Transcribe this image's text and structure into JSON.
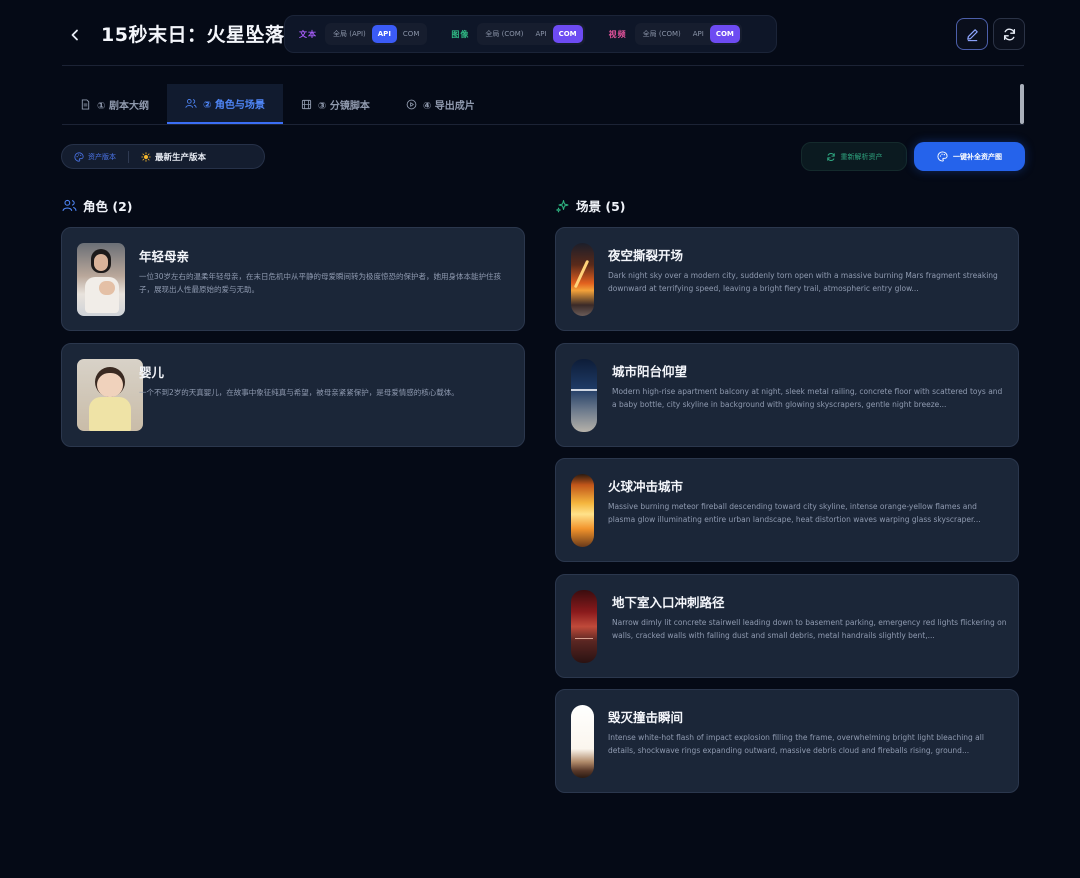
{
  "header": {
    "title": "15秒末日：火星坠落",
    "model_groups": [
      {
        "label": "文本",
        "color": "#a45cf6",
        "options": [
          "全局 (API)",
          "API",
          "COM"
        ],
        "selected": "API"
      },
      {
        "label": "图像",
        "color": "#2fb783",
        "options": [
          "全局 (COM)",
          "API",
          "COM"
        ],
        "selected": "COM"
      },
      {
        "label": "视频",
        "color": "#e0529a",
        "options": [
          "全局 (COM)",
          "API",
          "COM"
        ],
        "selected": "COM"
      }
    ]
  },
  "tabs": [
    {
      "label": "① 剧本大纲",
      "icon": "document-icon",
      "active": false
    },
    {
      "label": "② 角色与场景",
      "icon": "users-icon",
      "active": true
    },
    {
      "label": "③ 分镜脚本",
      "icon": "film-icon",
      "active": false
    },
    {
      "label": "④ 导出成片",
      "icon": "play-circle-icon",
      "active": false
    }
  ],
  "version": {
    "label": "资产版本",
    "value": "最新生产版本"
  },
  "actions": {
    "reparse": "重新解析资产",
    "fill_all": "一键补全资产图"
  },
  "characters": {
    "header": "角色 (2)",
    "items": [
      {
        "name": "年轻母亲",
        "desc": "一位30岁左右的温柔年轻母亲，在末日危机中从平静的母爱瞬间转为极度惊恐的保护者，她用身体本能护住孩子，展现出人性最原始的爱与无助。"
      },
      {
        "name": "婴儿",
        "desc": "一个不到2岁的天真婴儿，在故事中象征纯真与希望，被母亲紧紧保护，是母爱情感的核心载体。"
      }
    ]
  },
  "scenes": {
    "header": "场景 (5)",
    "items": [
      {
        "name": "夜空撕裂开场",
        "desc": "Dark night sky over a modern city, suddenly torn open with a massive burning Mars fragment streaking downward at terrifying speed, leaving a bright fiery trail, atmospheric entry glow..."
      },
      {
        "name": "城市阳台仰望",
        "desc": "Modern high-rise apartment balcony at night, sleek metal railing, concrete floor with scattered toys and a baby bottle, city skyline in background with glowing skyscrapers, gentle night breeze..."
      },
      {
        "name": "火球冲击城市",
        "desc": "Massive burning meteor fireball descending toward city skyline, intense orange-yellow flames and plasma glow illuminating entire urban landscape, heat distortion waves warping glass skyscraper..."
      },
      {
        "name": "地下室入口冲刺路径",
        "desc": "Narrow dimly lit concrete stairwell leading down to basement parking, emergency red lights flickering on walls, cracked walls with falling dust and small debris, metal handrails slightly bent,..."
      },
      {
        "name": "毁灭撞击瞬间",
        "desc": "Intense white-hot flash of impact explosion filling the frame, overwhelming bright light bleaching all details, shockwave rings expanding outward, massive debris cloud and fireballs rising, ground..."
      }
    ]
  }
}
